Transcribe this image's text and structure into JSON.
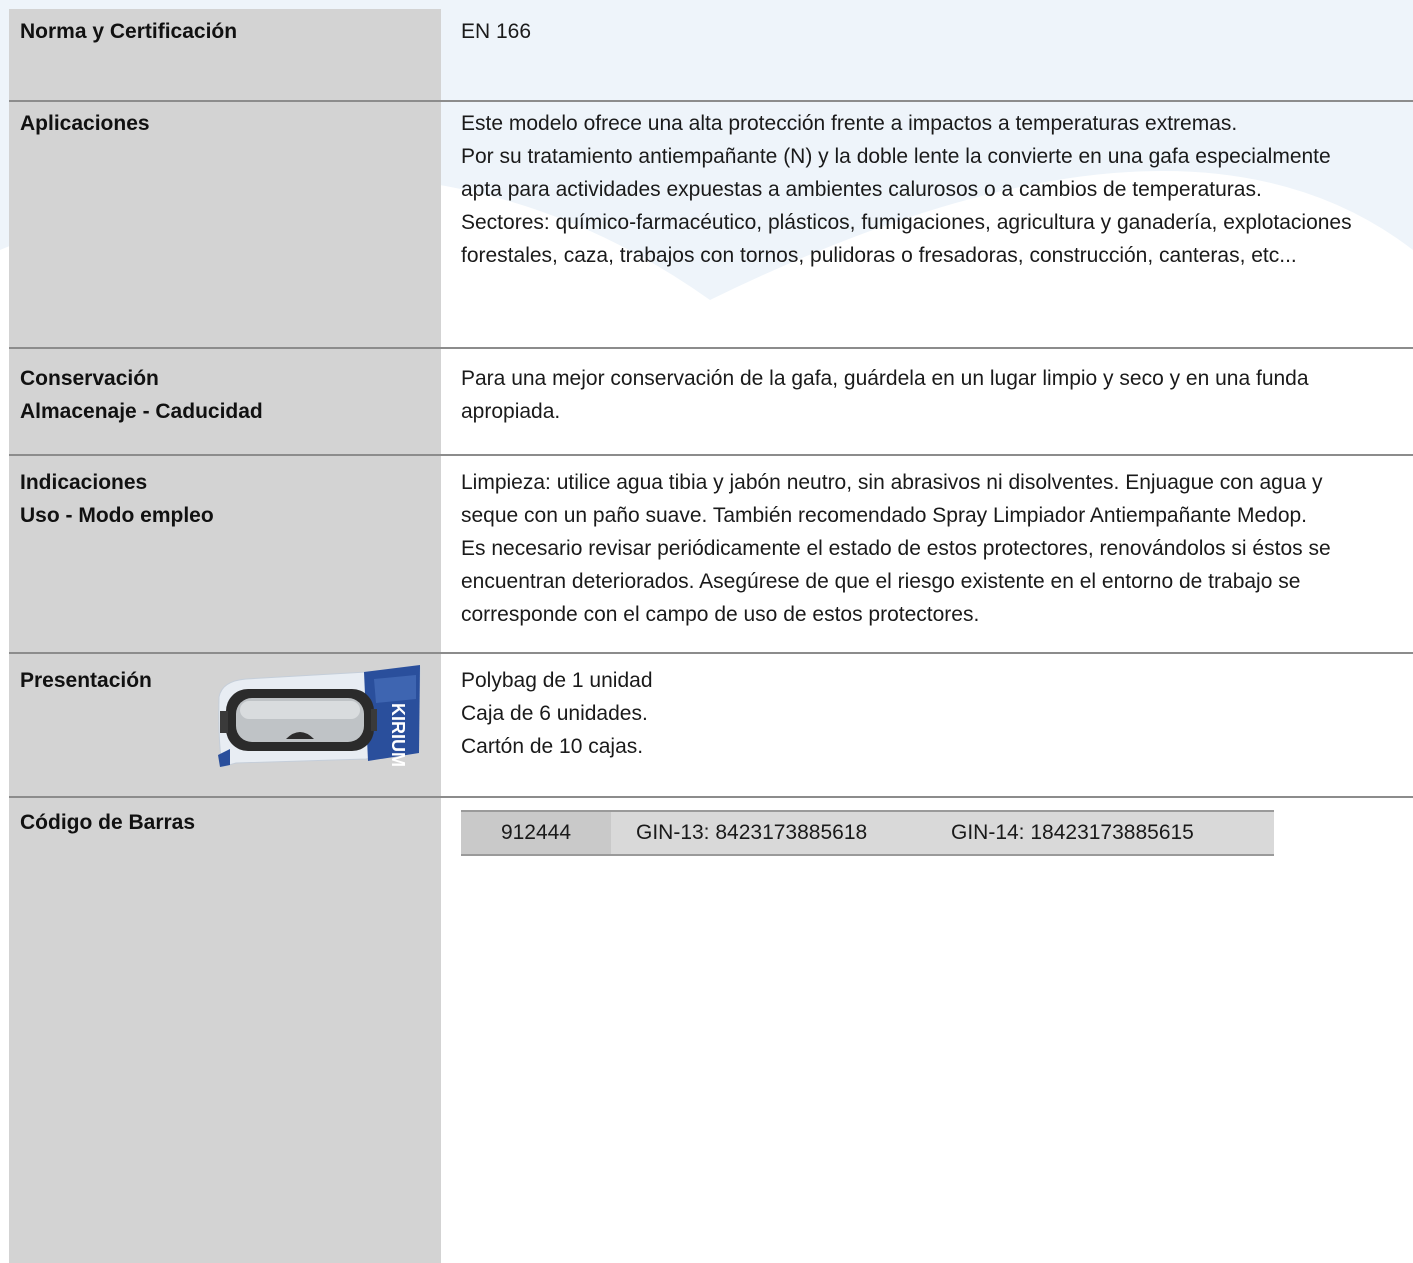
{
  "rows": {
    "norma": {
      "label": "Norma y Certificación",
      "value": "EN 166"
    },
    "aplicaciones": {
      "label": "Aplicaciones",
      "lines": [
        "Este modelo ofrece una alta protección frente a impactos a temperaturas extremas.",
        "Por su tratamiento antiempañante (N) y la doble lente la convierte en una gafa especialmente",
        "apta para actividades expuestas a ambientes calurosos o a cambios de temperaturas.",
        "Sectores: químico-farmacéutico, plásticos, fumigaciones, agricultura y ganadería, explotaciones",
        "forestales, caza, trabajos con tornos, pulidoras o fresadoras, construcción, canteras, etc..."
      ]
    },
    "conservacion": {
      "label_1": "Conservación",
      "label_2": "Almacenaje - Caducidad",
      "lines": [
        "Para una mejor conservación de la gafa, guárdela en un lugar limpio y seco y en una funda",
        "apropiada."
      ]
    },
    "indicaciones": {
      "label_1": "Indicaciones",
      "label_2": "Uso - Modo empleo",
      "lines": [
        "Limpieza: utilice agua tibia y jabón neutro, sin abrasivos ni disolventes. Enjuague con agua y",
        "seque con un paño suave. También recomendado Spray  Limpiador Antiempañante Medop.",
        "Es necesario revisar periódicamente el estado de estos protectores, renovándolos si éstos se",
        "encuentran deteriorados. Asegúrese de que el riesgo existente en el entorno de trabajo se",
        "corresponde con el campo de uso de estos protectores."
      ]
    },
    "presentacion": {
      "label": "Presentación",
      "image_brand": "KIRIUM",
      "lines": [
        "Polybag de 1 unidad",
        "Caja de 6 unidades.",
        "Cartón de 10 cajas."
      ]
    },
    "codigo": {
      "label": "Código de Barras",
      "code": "912444",
      "gin13": "GIN-13: 8423173885618",
      "gin14": "GIN-14: 18423173885615"
    }
  },
  "colors": {
    "label_column": "#d3d3d3",
    "background_shape": "#eef4fa",
    "separator": "#8c8c8c",
    "bag_blue": "#2a4f9c"
  }
}
